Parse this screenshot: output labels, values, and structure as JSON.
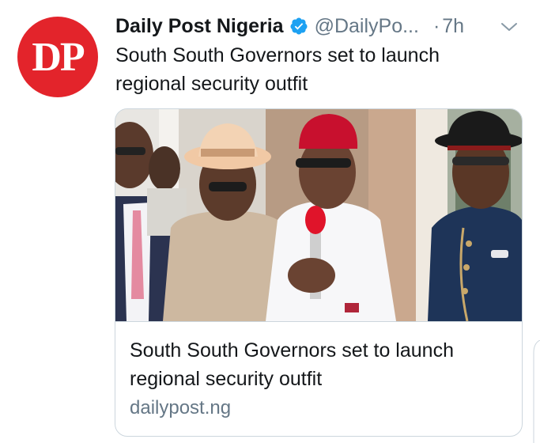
{
  "tweet": {
    "author": {
      "avatar_text": "DP",
      "display_name": "Daily Post Nigeria",
      "handle": "@DailyPo...",
      "verified": true
    },
    "separator": "·",
    "time": "7h",
    "text": "South South Governors set to launch regional security outfit",
    "card": {
      "image_icon": "photo-of-four-governors",
      "title": "South South Governors set to launch regional security outfit",
      "domain": "dailypost.ng"
    }
  },
  "colors": {
    "avatar_bg": "#e3242b",
    "verified_blue": "#1da1f2",
    "secondary_text": "#657786",
    "border": "#ccd6dd"
  }
}
